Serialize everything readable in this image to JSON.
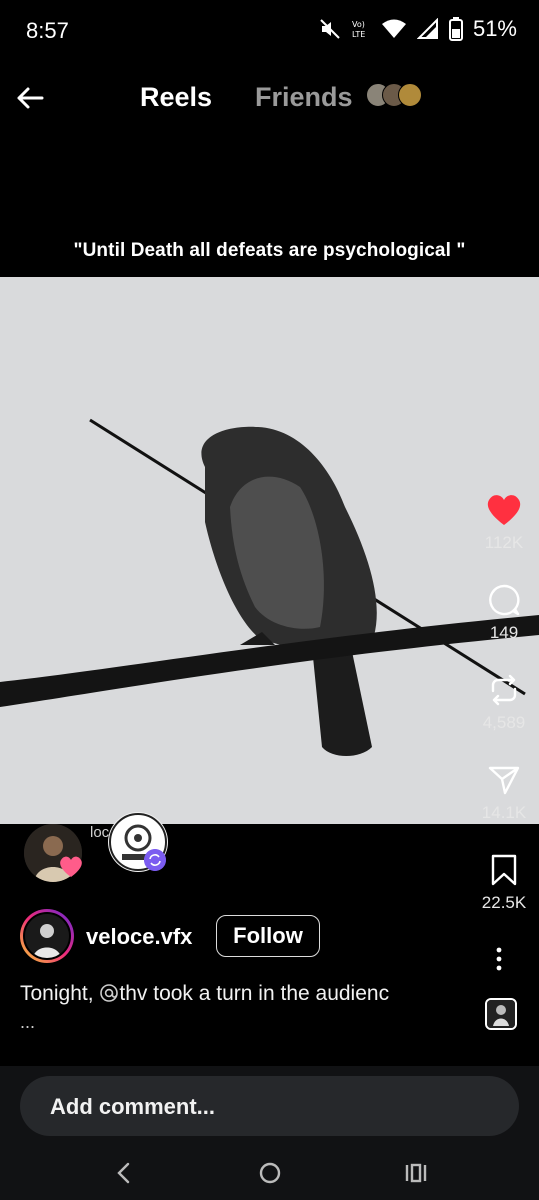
{
  "status": {
    "time": "8:57",
    "battery": "51%"
  },
  "header": {
    "tabs": [
      {
        "label": "Reels"
      },
      {
        "label": "Friends"
      }
    ]
  },
  "reel": {
    "caption_overlay": "\"Until Death all defeats are psychological \"",
    "collab_name_partial": "loce",
    "actions": {
      "likes": "112K",
      "comments": "149",
      "reposts": "4,589",
      "shares": "14.1K",
      "saves": "22.5K"
    },
    "author": {
      "username": "veloce.vfx",
      "follow_label": "Follow"
    },
    "description_prefix": "Tonight, ",
    "description_mention": "thv",
    "description_rest": " took a turn in the audienc",
    "description_more": "..."
  },
  "comment_box": {
    "placeholder": "Add comment..."
  },
  "colors": {
    "like": "#ff3040",
    "accent_purple": "#7b5cf0",
    "background": "#000000",
    "follow_border": "#dcdcdc"
  },
  "icons": [
    "mute-icon",
    "volte-icon",
    "wifi-icon",
    "signal-icon",
    "battery-icon",
    "back-arrow-icon",
    "heart-icon",
    "comment-icon",
    "repost-icon",
    "share-icon",
    "bookmark-icon",
    "more-icon",
    "nav-back-icon",
    "nav-home-icon",
    "nav-recents-icon"
  ]
}
